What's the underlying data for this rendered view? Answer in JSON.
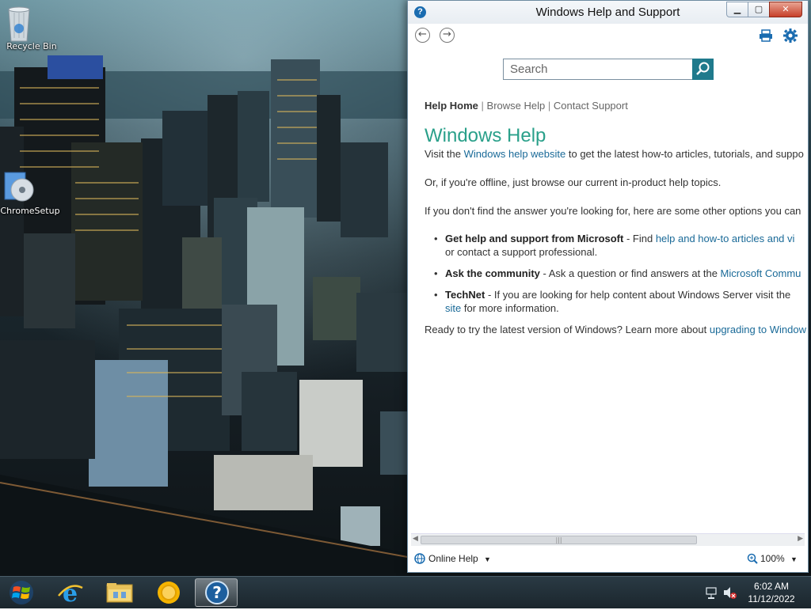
{
  "desktop": {
    "icons": [
      {
        "label": "Recycle Bin",
        "icon": "recycle-bin-icon"
      },
      {
        "label": "ChromeSetup",
        "icon": "chrome-setup-icon"
      }
    ]
  },
  "window": {
    "title": "Windows Help and Support",
    "min_glyph": "▁",
    "max_glyph": "▢",
    "close_glyph": "✕",
    "toolbar": {
      "back_glyph": "←",
      "forward_glyph": "→"
    },
    "search": {
      "placeholder": "Search"
    },
    "breadcrumb": {
      "home": "Help Home",
      "sep": "|",
      "browse": "Browse Help",
      "contact": "Contact Support"
    },
    "content": {
      "title": "Windows Help",
      "p1_before": "Visit the ",
      "p1_link": "Windows help website",
      "p1_after": " to get the latest how-to articles, tutorials, and suppo",
      "p2": "Or, if you're offline, just browse our current in-product help topics.",
      "p3": "If you don't find the answer you're looking for, here are some other options you can",
      "bullets": [
        {
          "bold": "Get help and support from Microsoft",
          "text": " - Find ",
          "link": "help and how-to articles and vi",
          "line2": "or contact a support professional."
        },
        {
          "bold": "Ask the community",
          "text": " - Ask a question or find answers at the ",
          "link": "Microsoft Commu"
        },
        {
          "bold": "TechNet",
          "text": " - If you are looking for help content about Windows Server visit the",
          "link2": "site",
          "line2": " for more information."
        }
      ],
      "p4_before": "Ready to try the latest version of Windows? Learn more about ",
      "p4_link": "upgrading to Window"
    },
    "scrollbar_grip": "|||",
    "status": {
      "online_help": "Online Help",
      "dropdown_glyph": "▼",
      "zoom": "100%"
    }
  },
  "taskbar": {
    "items": [
      {
        "name": "internet-explorer"
      },
      {
        "name": "file-explorer"
      },
      {
        "name": "chrome-setup"
      },
      {
        "name": "windows-help",
        "active": true
      }
    ],
    "clock": {
      "time": "6:02 AM",
      "date": "11/12/2022"
    }
  },
  "colors": {
    "accent_teal": "#2aa08a",
    "link_blue": "#1a6a98",
    "search_button": "#1f7a8c"
  }
}
